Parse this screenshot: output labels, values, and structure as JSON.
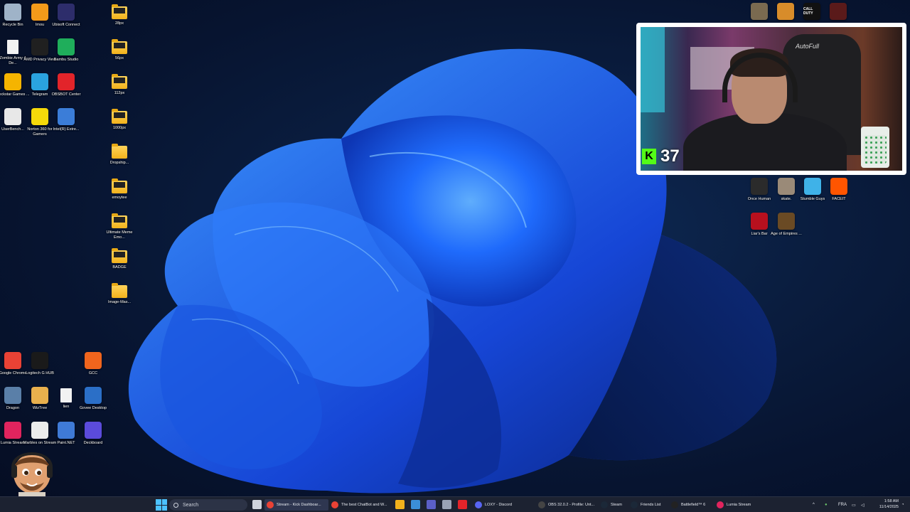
{
  "desktop": {
    "left_icons": [
      {
        "label": "Recycle Bin",
        "icon": "recycle-bin-icon",
        "color": "#9fb3c8"
      },
      {
        "label": "Imou",
        "icon": "imou-icon",
        "color": "#f39a1a"
      },
      {
        "label": "Ubisoft Connect",
        "icon": "ubisoft-icon",
        "color": "#2d2d6b"
      },
      {
        "label": "Zombie Army 4 De...",
        "icon": "file-icon",
        "color": "#f2f2f2"
      },
      {
        "label": "AMD Privacy View",
        "icon": "amd-icon",
        "color": "#202020"
      },
      {
        "label": "Bambu Studio",
        "icon": "bambu-icon",
        "color": "#1fae5b"
      },
      {
        "label": "Rockstar Games ...",
        "icon": "rockstar-icon",
        "color": "#f5b400"
      },
      {
        "label": "Telegram",
        "icon": "telegram-icon",
        "color": "#2aa3df"
      },
      {
        "label": "OBSBOT Center",
        "icon": "obsbot-icon",
        "color": "#e2242a"
      },
      {
        "label": "UserBench...",
        "icon": "userbench-icon",
        "color": "#e8e8e8"
      },
      {
        "label": "Norton 360 for Gamers",
        "icon": "norton-icon",
        "color": "#f5d90a"
      },
      {
        "label": "Intel(R) Extre...",
        "icon": "intel-icon",
        "color": "#3b7dd8"
      }
    ],
    "folder_icons": [
      {
        "label": "28px",
        "thumb": true
      },
      {
        "label": "56px",
        "thumb": true
      },
      {
        "label": "112px",
        "thumb": true
      },
      {
        "label": "1000px",
        "thumb": true
      },
      {
        "label": "Dropship...",
        "thumb": false
      },
      {
        "label": "emoytee",
        "thumb": true
      },
      {
        "label": "Ultimate Meme Emo...",
        "thumb": true
      },
      {
        "label": "BADGE",
        "thumb": true
      },
      {
        "label": "Image-Mas...",
        "thumb": false
      }
    ],
    "bottom_icons": [
      {
        "label": "Google Chrome",
        "icon": "chrome-icon",
        "color": "#e94235"
      },
      {
        "label": "Logitech G HUB",
        "icon": "logitech-icon",
        "color": "#1a1a1a"
      },
      {
        "label": "GCC",
        "icon": "gcc-icon",
        "color": "#f0651d"
      },
      {
        "label": "Dragon",
        "icon": "dragon-icon",
        "color": "#5a7fa8"
      },
      {
        "label": "WizTree",
        "icon": "wiztree-icon",
        "color": "#e9b04d"
      },
      {
        "label": "lien",
        "icon": "file-icon",
        "color": "#f2f2f2"
      },
      {
        "label": "Govee Desktop",
        "icon": "govee-icon",
        "color": "#2b6fc7"
      },
      {
        "label": "Lumia Stream",
        "icon": "lumia-icon",
        "color": "#e0245e"
      },
      {
        "label": "Marbles on Stream",
        "icon": "marbles-icon",
        "color": "#ececec"
      },
      {
        "label": "Paint.NET",
        "icon": "paintnet-icon",
        "color": "#3f7ad6"
      },
      {
        "label": "Deckboard",
        "icon": "deckboard-icon",
        "color": "#5b4bdb"
      }
    ],
    "right_icons": [
      {
        "label": "Once Human",
        "icon": "once-human-icon",
        "color": "#2b2b2b"
      },
      {
        "label": "skate.",
        "icon": "skate-icon",
        "color": "#9a8a78"
      },
      {
        "label": "Stumble Guys",
        "icon": "stumble-guys-icon",
        "color": "#3fb2e8"
      },
      {
        "label": "FACEIT",
        "icon": "faceit-icon",
        "color": "#ff5500"
      },
      {
        "label": "Liar's Bar",
        "icon": "liars-bar-icon",
        "color": "#b8101e"
      },
      {
        "label": "Age of Empires ...",
        "icon": "age-of-empires-icon",
        "color": "#6a4a24"
      }
    ],
    "top_right_icons": [
      {
        "label": "",
        "icon": "game-thumb-icon",
        "color": "#7a6a50"
      },
      {
        "label": "",
        "icon": "game-thumb-icon",
        "color": "#d88c2a"
      },
      {
        "label": "CALL DUTY",
        "icon": "call-of-duty-icon",
        "color": "#111111"
      },
      {
        "label": "",
        "icon": "game-thumb-icon",
        "color": "#5a1a1a"
      }
    ]
  },
  "webcam": {
    "chair_brand": "AutoFull",
    "kick_letter": "K",
    "viewer_count": "37",
    "kick_color": "#53fc18"
  },
  "taskbar": {
    "search_placeholder": "Search",
    "apps": [
      {
        "label": "Stream - Kick Dashboar...",
        "icon": "chrome-icon",
        "color": "#e94235",
        "active": true
      },
      {
        "label": "The best ChatBot and W...",
        "icon": "chrome-icon",
        "color": "#e94235",
        "active": false
      },
      {
        "label": "LOXY - Discord",
        "icon": "discord-icon",
        "color": "#5865f2",
        "active": false
      },
      {
        "label": "OBS 32.0.2 - Profile: Unt...",
        "icon": "obs-icon",
        "color": "#444444",
        "active": false
      },
      {
        "label": "Steam",
        "icon": "steam-icon",
        "color": "#1b2838",
        "active": false
      },
      {
        "label": "Friends List",
        "icon": "steam-friends-icon",
        "color": "#1b2838",
        "active": false
      },
      {
        "label": "Battlefield™ 6",
        "icon": "battlefield-icon",
        "color": "#222222",
        "active": false
      },
      {
        "label": "Lumia Stream",
        "icon": "lumia-icon",
        "color": "#e0245e",
        "active": false
      }
    ],
    "pinned": [
      {
        "icon": "task-view-icon",
        "color": "#cfd3dc"
      },
      {
        "icon": "file-explorer-icon",
        "color": "#f2b21c"
      },
      {
        "icon": "store-icon",
        "color": "#3b8fd9"
      },
      {
        "icon": "teams-icon",
        "color": "#5b5fc7"
      },
      {
        "icon": "settings-icon",
        "color": "#9aa3b5"
      },
      {
        "icon": "obsbot-icon",
        "color": "#e2242a"
      }
    ],
    "tray": {
      "language": "FRA",
      "time": "1:58 AM",
      "date": "11/14/2025"
    }
  }
}
